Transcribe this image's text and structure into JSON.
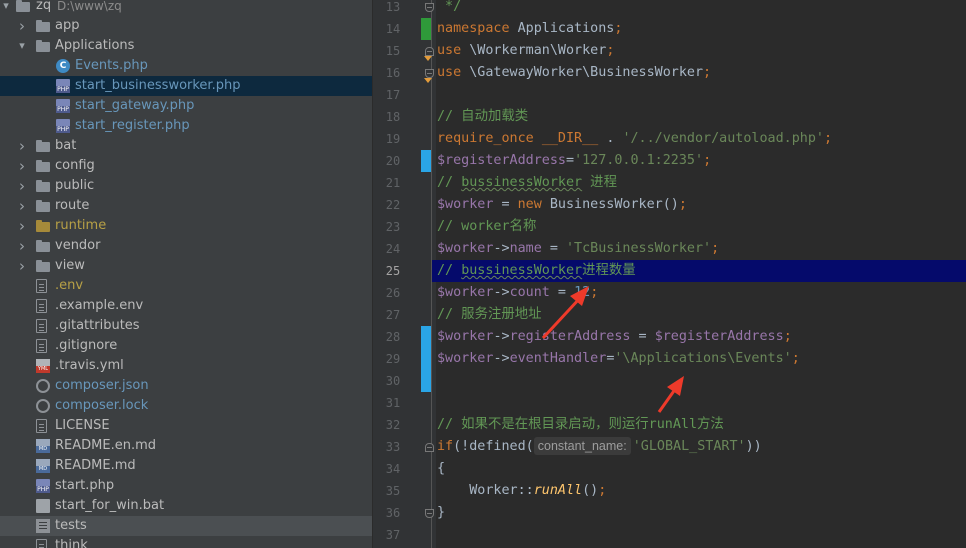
{
  "project_tree": {
    "root": {
      "name": "zq",
      "path": "D:\\www\\zq"
    },
    "items": [
      {
        "label": "app",
        "kind": "folder",
        "state": "collapsed",
        "depth": 1
      },
      {
        "label": "Applications",
        "kind": "folder",
        "state": "expanded",
        "depth": 1
      },
      {
        "label": "Events.php",
        "kind": "class",
        "depth": 2,
        "color": "#6897bb"
      },
      {
        "label": "start_businessworker.php",
        "kind": "php",
        "depth": 2,
        "color": "#6897bb",
        "selected": true
      },
      {
        "label": "start_gateway.php",
        "kind": "php",
        "depth": 2,
        "color": "#6897bb"
      },
      {
        "label": "start_register.php",
        "kind": "php",
        "depth": 2,
        "color": "#6897bb"
      },
      {
        "label": "bat",
        "kind": "folder",
        "state": "collapsed",
        "depth": 1
      },
      {
        "label": "config",
        "kind": "folder",
        "state": "collapsed",
        "depth": 1
      },
      {
        "label": "public",
        "kind": "folder",
        "state": "collapsed",
        "depth": 1
      },
      {
        "label": "route",
        "kind": "folder",
        "state": "collapsed",
        "depth": 1
      },
      {
        "label": "runtime",
        "kind": "folder-excluded",
        "state": "collapsed",
        "depth": 1,
        "color": "#b7a046"
      },
      {
        "label": "vendor",
        "kind": "folder",
        "state": "collapsed",
        "depth": 1
      },
      {
        "label": "view",
        "kind": "folder",
        "state": "collapsed",
        "depth": 1
      },
      {
        "label": ".env",
        "kind": "file",
        "depth": 1,
        "color": "#b7a046"
      },
      {
        "label": ".example.env",
        "kind": "file",
        "depth": 1
      },
      {
        "label": ".gitattributes",
        "kind": "file",
        "depth": 1
      },
      {
        "label": ".gitignore",
        "kind": "file",
        "depth": 1
      },
      {
        "label": ".travis.yml",
        "kind": "yml",
        "depth": 1
      },
      {
        "label": "composer.json",
        "kind": "gear",
        "depth": 1,
        "color": "#6897bb"
      },
      {
        "label": "composer.lock",
        "kind": "gear",
        "depth": 1,
        "color": "#6897bb"
      },
      {
        "label": "LICENSE",
        "kind": "file",
        "depth": 1
      },
      {
        "label": "README.en.md",
        "kind": "md",
        "depth": 1
      },
      {
        "label": "README.md",
        "kind": "md",
        "depth": 1
      },
      {
        "label": "start.php",
        "kind": "php",
        "depth": 1
      },
      {
        "label": "start_for_win.bat",
        "kind": "bat",
        "depth": 1
      },
      {
        "label": "tests",
        "kind": "tests",
        "depth": 1,
        "hover": true
      },
      {
        "label": "think",
        "kind": "file",
        "depth": 1
      }
    ]
  },
  "editor": {
    "current_line": "25",
    "lines": [
      {
        "n": "13",
        "tokens": [
          [
            "cm",
            " */"
          ]
        ]
      },
      {
        "n": "14",
        "tokens": [
          [
            "kw",
            "namespace "
          ],
          [
            "tx",
            "Applications"
          ],
          [
            "kw",
            ";"
          ]
        ],
        "mark": "added"
      },
      {
        "n": "15",
        "tokens": [
          [
            "kw",
            "use "
          ],
          [
            "tx",
            "\\Workerman\\Worker"
          ],
          [
            "kw",
            ";"
          ]
        ]
      },
      {
        "n": "16",
        "tokens": [
          [
            "kw",
            "use "
          ],
          [
            "tx",
            "\\GatewayWorker\\BusinessWorker"
          ],
          [
            "kw",
            ";"
          ]
        ]
      },
      {
        "n": "17",
        "tokens": []
      },
      {
        "n": "18",
        "tokens": [
          [
            "cm",
            "// 自动加载类"
          ]
        ]
      },
      {
        "n": "19",
        "tokens": [
          [
            "kw",
            "require_once "
          ],
          [
            "kw",
            "__DIR__ "
          ],
          [
            "tx",
            ". "
          ],
          [
            "st",
            "'/../vendor/autoload.php'"
          ],
          [
            "kw",
            ";"
          ]
        ]
      },
      {
        "n": "20",
        "tokens": [
          [
            "vr",
            "$registerAddress"
          ],
          [
            "tx",
            "="
          ],
          [
            "st",
            "'127.0.0.1:2235'"
          ],
          [
            "kw",
            ";"
          ]
        ],
        "mark": "modified"
      },
      {
        "n": "21",
        "tokens": [
          [
            "cm",
            "// "
          ],
          [
            "cmu",
            "bussinessWorker"
          ],
          [
            "cm",
            " 进程"
          ]
        ]
      },
      {
        "n": "22",
        "tokens": [
          [
            "vr",
            "$worker"
          ],
          [
            "tx",
            " = "
          ],
          [
            "kw",
            "new "
          ],
          [
            "tx",
            "BusinessWorker()"
          ],
          [
            "kw",
            ";"
          ]
        ]
      },
      {
        "n": "23",
        "tokens": [
          [
            "cm",
            "// worker名称"
          ]
        ]
      },
      {
        "n": "24",
        "tokens": [
          [
            "vr",
            "$worker"
          ],
          [
            "tx",
            "->"
          ],
          [
            "vr",
            "name"
          ],
          [
            "tx",
            " = "
          ],
          [
            "st",
            "'TcBusinessWorker'"
          ],
          [
            "kw",
            ";"
          ]
        ]
      },
      {
        "n": "25",
        "tokens": [
          [
            "cm",
            "// "
          ],
          [
            "cmu",
            "bussinessWorker"
          ],
          [
            "cm",
            "进程数量"
          ]
        ]
      },
      {
        "n": "26",
        "tokens": [
          [
            "vr",
            "$worker"
          ],
          [
            "tx",
            "->"
          ],
          [
            "vr",
            "count"
          ],
          [
            "tx",
            " = "
          ],
          [
            "nm",
            "12"
          ],
          [
            "kw",
            ";"
          ]
        ]
      },
      {
        "n": "27",
        "tokens": [
          [
            "cm",
            "// 服务注册地址"
          ]
        ]
      },
      {
        "n": "28",
        "tokens": [
          [
            "vr",
            "$worker"
          ],
          [
            "tx",
            "->"
          ],
          [
            "vr",
            "registerAddress"
          ],
          [
            "tx",
            " = "
          ],
          [
            "vr",
            "$registerAddress"
          ],
          [
            "kw",
            ";"
          ]
        ],
        "mark": "modified"
      },
      {
        "n": "29",
        "tokens": [
          [
            "vr",
            "$worker"
          ],
          [
            "tx",
            "->"
          ],
          [
            "vr",
            "eventHandler"
          ],
          [
            "tx",
            "="
          ],
          [
            "st",
            "'\\Applications\\Events'"
          ],
          [
            "kw",
            ";"
          ]
        ],
        "mark": "modified"
      },
      {
        "n": "30",
        "tokens": [],
        "mark": "modified"
      },
      {
        "n": "31",
        "tokens": []
      },
      {
        "n": "32",
        "tokens": [
          [
            "cm",
            "// 如果不是在根目录启动，则运行runAll方法"
          ]
        ]
      },
      {
        "n": "33",
        "tokens": [
          [
            "kw",
            "if"
          ],
          [
            "tx",
            "(!defined("
          ],
          [
            "hint",
            "constant_name:"
          ],
          [
            "st",
            "'GLOBAL_START'"
          ],
          [
            "tx",
            "))"
          ]
        ]
      },
      {
        "n": "34",
        "tokens": [
          [
            "tx",
            "{"
          ]
        ]
      },
      {
        "n": "35",
        "tokens": [
          [
            "tx",
            "    Worker::"
          ],
          [
            "it",
            "runAll"
          ],
          [
            "tx",
            "()"
          ],
          [
            "kw",
            ";"
          ]
        ]
      },
      {
        "n": "36",
        "tokens": [
          [
            "tx",
            "}"
          ]
        ]
      },
      {
        "n": "37",
        "tokens": []
      }
    ]
  },
  "colors": {
    "added": "#2f9a3a",
    "modified": "#2aa5e6",
    "annotation_arrow": "#ee3a2a"
  }
}
